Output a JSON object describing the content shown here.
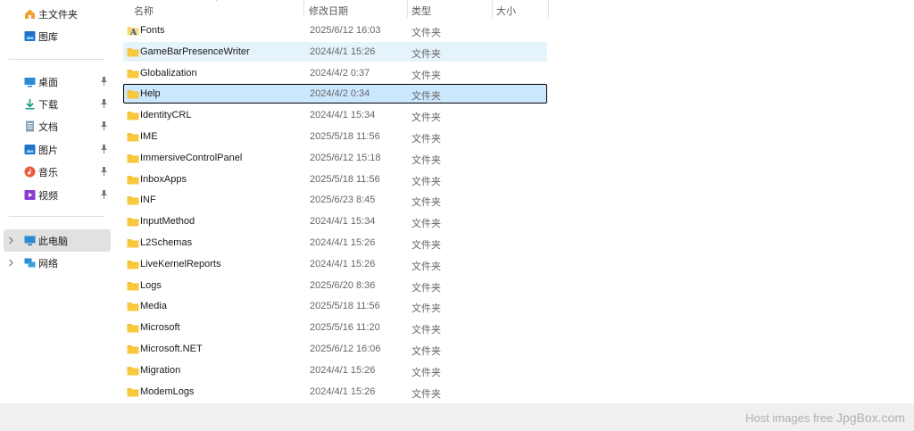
{
  "sidebar": {
    "quick": [
      {
        "label": "主文件夹",
        "icon": "home-icon"
      },
      {
        "label": "图库",
        "icon": "gallery-icon"
      }
    ],
    "pinned": [
      {
        "label": "桌面",
        "icon": "desktop-icon"
      },
      {
        "label": "下载",
        "icon": "download-icon"
      },
      {
        "label": "文档",
        "icon": "document-icon"
      },
      {
        "label": "图片",
        "icon": "pictures-icon"
      },
      {
        "label": "音乐",
        "icon": "music-icon"
      },
      {
        "label": "视频",
        "icon": "video-icon"
      }
    ],
    "drives": [
      {
        "label": "此电脑",
        "icon": "this-pc-icon",
        "selected": true
      },
      {
        "label": "网络",
        "icon": "network-icon",
        "selected": false
      }
    ]
  },
  "columns": {
    "name": "名称",
    "modified": "修改日期",
    "type": "类型",
    "size": "大小"
  },
  "files": [
    {
      "name": "Fonts",
      "date": "2025/6/12 16:03",
      "type": "文件夹",
      "icon": "fonts-folder-icon"
    },
    {
      "name": "GameBarPresenceWriter",
      "date": "2024/4/1 15:26",
      "type": "文件夹",
      "icon": "folder-icon",
      "state": "hover"
    },
    {
      "name": "Globalization",
      "date": "2024/4/2 0:37",
      "type": "文件夹",
      "icon": "folder-icon"
    },
    {
      "name": "Help",
      "date": "2024/4/2 0:34",
      "type": "文件夹",
      "icon": "folder-icon",
      "state": "selected"
    },
    {
      "name": "IdentityCRL",
      "date": "2024/4/1 15:34",
      "type": "文件夹",
      "icon": "folder-icon"
    },
    {
      "name": "IME",
      "date": "2025/5/18 11:56",
      "type": "文件夹",
      "icon": "folder-icon"
    },
    {
      "name": "ImmersiveControlPanel",
      "date": "2025/6/12 15:18",
      "type": "文件夹",
      "icon": "folder-icon"
    },
    {
      "name": "InboxApps",
      "date": "2025/5/18 11:56",
      "type": "文件夹",
      "icon": "folder-icon"
    },
    {
      "name": "INF",
      "date": "2025/6/23 8:45",
      "type": "文件夹",
      "icon": "folder-icon"
    },
    {
      "name": "InputMethod",
      "date": "2024/4/1 15:34",
      "type": "文件夹",
      "icon": "folder-icon"
    },
    {
      "name": "L2Schemas",
      "date": "2024/4/1 15:26",
      "type": "文件夹",
      "icon": "folder-icon"
    },
    {
      "name": "LiveKernelReports",
      "date": "2024/4/1 15:26",
      "type": "文件夹",
      "icon": "folder-icon"
    },
    {
      "name": "Logs",
      "date": "2025/6/20 8:36",
      "type": "文件夹",
      "icon": "folder-icon"
    },
    {
      "name": "Media",
      "date": "2025/5/18 11:56",
      "type": "文件夹",
      "icon": "folder-icon"
    },
    {
      "name": "Microsoft",
      "date": "2025/5/16 11:20",
      "type": "文件夹",
      "icon": "folder-icon"
    },
    {
      "name": "Microsoft.NET",
      "date": "2025/6/12 16:06",
      "type": "文件夹",
      "icon": "folder-icon"
    },
    {
      "name": "Migration",
      "date": "2024/4/1 15:26",
      "type": "文件夹",
      "icon": "folder-icon"
    },
    {
      "name": "ModemLogs",
      "date": "2024/4/1 15:26",
      "type": "文件夹",
      "icon": "folder-icon"
    }
  ],
  "watermark": {
    "prefix": "Host images free ",
    "brand": "JpgBox.com"
  },
  "colors": {
    "selection": "#cce8ff",
    "hover": "#e5f3fb",
    "folder": "#f8c93e"
  }
}
